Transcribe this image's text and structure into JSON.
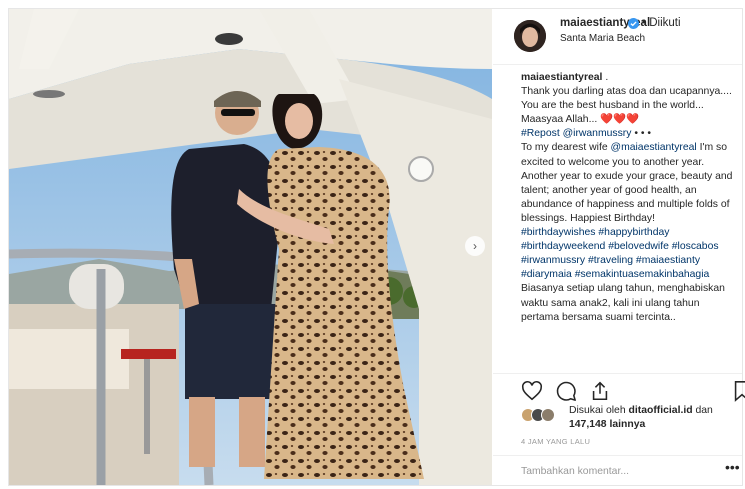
{
  "post": {
    "username": "maiaestiantyreal",
    "follow_status": "• Diikuti",
    "location": "Santa Maria Beach",
    "caption": [
      {
        "t": "maiaestiantyreal",
        "k": "user"
      },
      {
        "t": " .\nThank you darling atas doa dan ucapannya.... You are the best husband in the world... Maasyaa Allah... ",
        "k": "text"
      },
      {
        "t": "❤️❤️❤️",
        "k": "emoji"
      },
      {
        "t": "\n",
        "k": "text"
      },
      {
        "t": "#Repost @irwanmussry",
        "k": "tag"
      },
      {
        "t": " • • •\nTo my dearest wife ",
        "k": "text"
      },
      {
        "t": "@maiaestiantyreal",
        "k": "tag"
      },
      {
        "t": " I'm so excited to welcome you to another year. Another year to exude your grace, beauty and talent; another year of good health, an abundance of happiness and multiple folds of blessings. Happiest Birthday!\n",
        "k": "text"
      },
      {
        "t": "#birthdaywishes #happybirthday #birthdayweekend #belovedwife #loscabos #irwanmussry #traveling #maiaestianty #diarymaia #semakintuasemakinbahagia",
        "k": "tag"
      },
      {
        "t": "\nBiasanya setiap ulang tahun, menghabiskan waktu sama anak2, kali ini ulang tahun pertama bersama suami tercinta..",
        "k": "text"
      }
    ],
    "liked_prefix": "Disukai oleh ",
    "liked_user": "ditaofficial.id",
    "liked_mid": " dan",
    "liked_count": "147,148 lainnya",
    "time": "4 JAM YANG LALU",
    "comment_placeholder": "Tambahkan komentar...",
    "more_label": "•••"
  },
  "icons": {
    "like": "heart-icon",
    "comment": "comment-icon",
    "share": "share-icon",
    "save": "bookmark-icon",
    "verified": "verified-badge-icon",
    "next": "chevron-right-icon"
  },
  "colors": {
    "link": "#003569",
    "verified": "#3897f0",
    "heart_red": "#ed4956",
    "border": "#efefef"
  }
}
